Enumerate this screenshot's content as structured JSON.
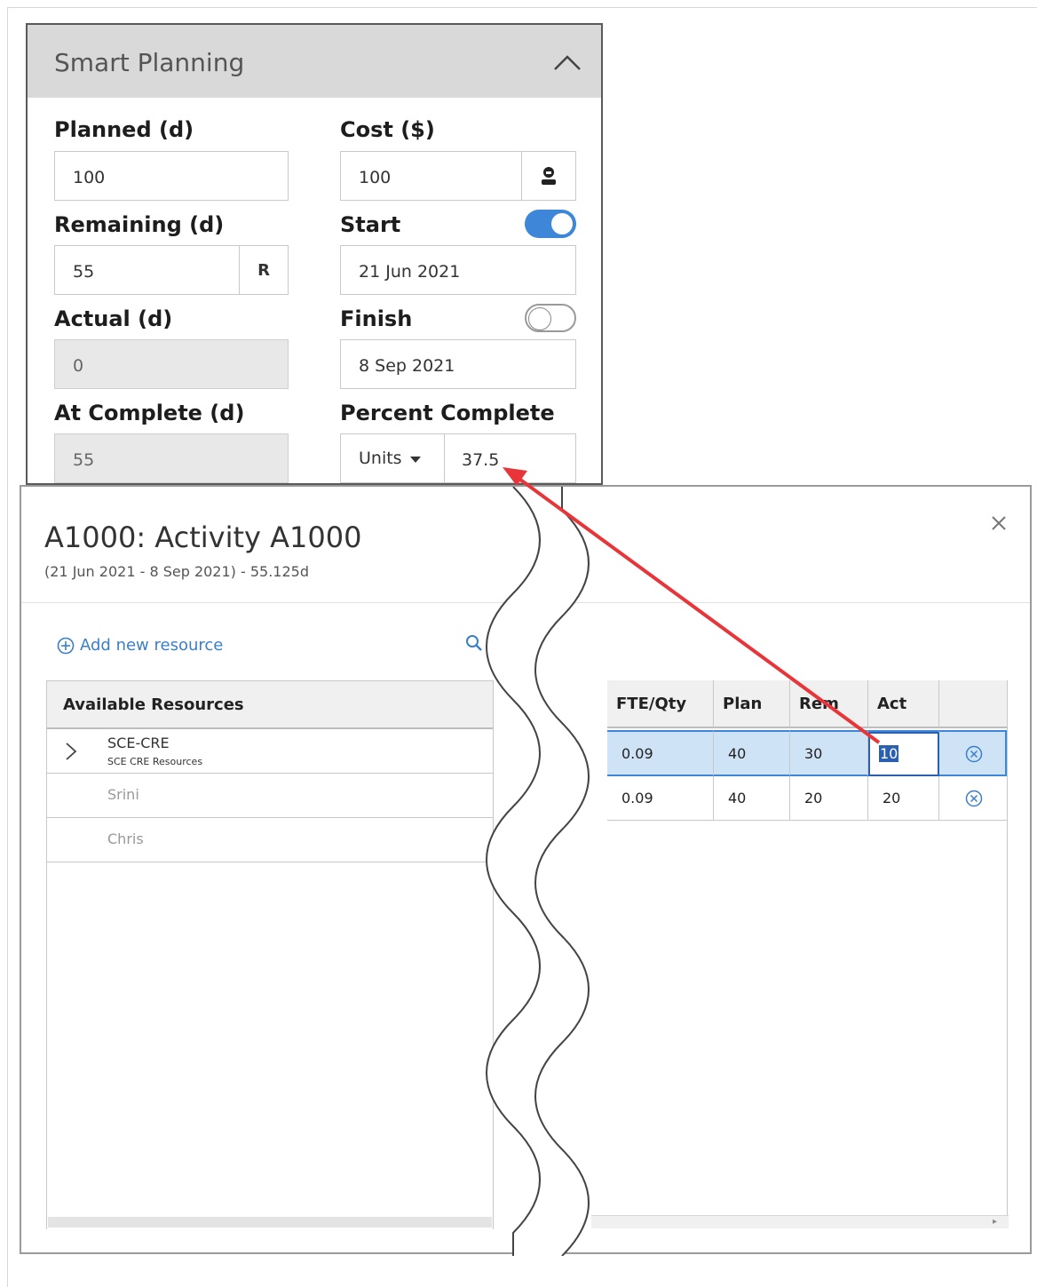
{
  "smart_planning": {
    "title": "Smart Planning",
    "planned": {
      "label": "Planned (d)",
      "value": "100"
    },
    "cost": {
      "label": "Cost ($)",
      "value": "100"
    },
    "remaining": {
      "label": "Remaining (d)",
      "value": "55",
      "addon": "R"
    },
    "start": {
      "label": "Start",
      "value": "21 Jun 2021",
      "toggle_on": true
    },
    "actual": {
      "label": "Actual (d)",
      "value": "0"
    },
    "finish": {
      "label": "Finish",
      "value": "8 Sep 2021",
      "toggle_on": false
    },
    "at_complete": {
      "label": "At Complete (d)",
      "value": "55"
    },
    "percent_complete": {
      "label": "Percent Complete",
      "type": "Units",
      "value": "37.5"
    }
  },
  "dialog": {
    "title": "A1000: Activity A1000",
    "subtitle": "(21 Jun 2021 - 8 Sep 2021) - 55.125d",
    "add_resource": "Add new resource",
    "resources": {
      "header": "Available Resources",
      "items": [
        {
          "name": "SCE-CRE",
          "desc": "SCE CRE Resources"
        },
        {
          "name": "Srini"
        },
        {
          "name": "Chris"
        }
      ]
    },
    "grid": {
      "headers": [
        "FTE/Qty",
        "Plan",
        "Rem",
        "Act"
      ],
      "rows": [
        {
          "fte": "0.09",
          "plan": "40",
          "rem": "30",
          "act": "10"
        },
        {
          "fte": "0.09",
          "plan": "40",
          "rem": "20",
          "act": "20"
        }
      ]
    }
  },
  "colors": {
    "accent": "#3d86d8",
    "arrow": "#e8353a",
    "link": "#3b7fc9"
  }
}
